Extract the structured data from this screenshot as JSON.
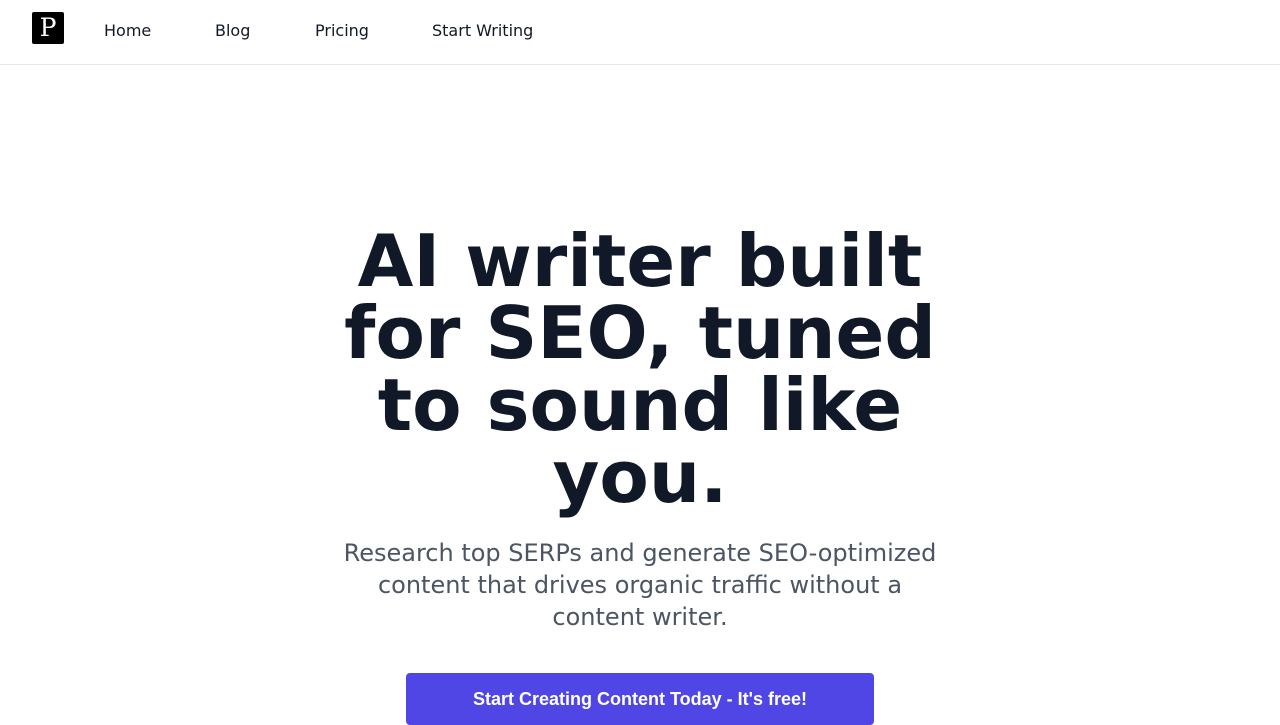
{
  "nav": {
    "logo_letter": "P",
    "links": [
      {
        "label": "Home"
      },
      {
        "label": "Blog"
      },
      {
        "label": "Pricing"
      },
      {
        "label": "Start Writing"
      }
    ]
  },
  "hero": {
    "title": "AI writer built for SEO, tuned to sound like you.",
    "subtitle": "Research top SERPs and generate SEO-optimized content that drives organic traffic without a content writer.",
    "cta_label": "Start Creating Content Today - It's free!"
  },
  "colors": {
    "accent": "#4f46e5",
    "heading": "#111827",
    "body_text": "#4b5563",
    "border": "#e5e7eb",
    "logo_bg": "#000000"
  }
}
